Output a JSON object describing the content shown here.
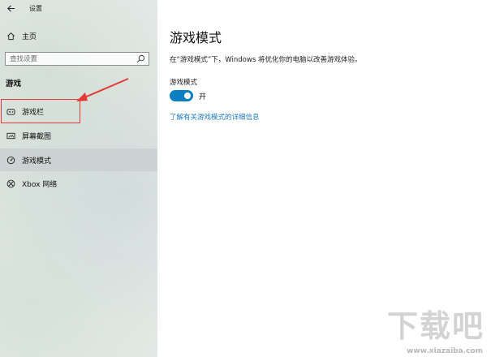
{
  "window": {
    "title": "设置"
  },
  "sidebar": {
    "home_label": "主页",
    "search_placeholder": "查找设置",
    "section_header": "游戏",
    "items": [
      {
        "label": "游戏栏",
        "icon": "game-bar-icon"
      },
      {
        "label": "屏幕截图",
        "icon": "capture-icon"
      },
      {
        "label": "游戏模式",
        "icon": "game-mode-icon",
        "selected": true
      },
      {
        "label": "Xbox 网络",
        "icon": "xbox-icon"
      }
    ]
  },
  "main": {
    "title": "游戏模式",
    "description": "在“游戏模式”下，Windows 将优化你的电脑以改善游戏体验。",
    "setting_label": "游戏模式",
    "toggle_state": "开",
    "toggle_on": true,
    "help_link": "了解有关游戏模式的详细信息"
  },
  "watermark": {
    "text": "下载吧",
    "url": "www.xiazaiba.com"
  },
  "colors": {
    "accent": "#0a7fc1",
    "link": "#1e7bc2",
    "annotation": "#e53935"
  }
}
